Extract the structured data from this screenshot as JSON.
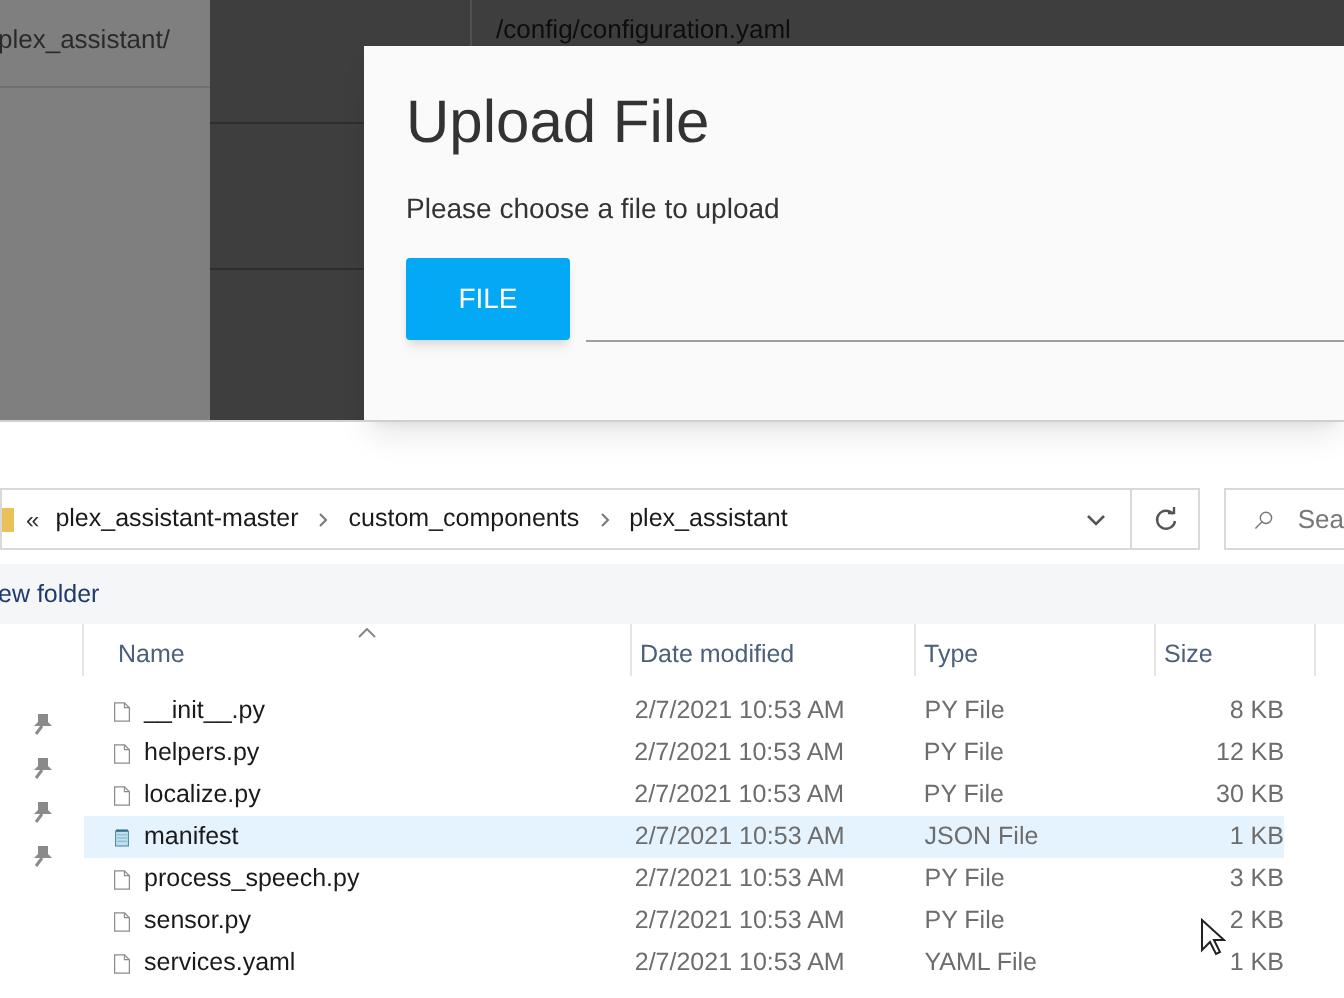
{
  "background_app": {
    "folder_path": "plex_assistant/",
    "file_path": "/config/configuration.yaml"
  },
  "dialog": {
    "title": "Upload File",
    "message": "Please choose a file to upload",
    "file_button": "FILE"
  },
  "explorer": {
    "breadcrumb": [
      "plex_assistant-master",
      "custom_components",
      "plex_assistant"
    ],
    "overflow": "«",
    "search_placeholder": "Sea",
    "toolbar": [
      "ew folder"
    ],
    "columns": [
      "Name",
      "Date modified",
      "Type",
      "Size"
    ],
    "rows": [
      {
        "kind": "file",
        "name": "__init__.py",
        "date": "2/7/2021 10:53 AM",
        "type": "PY File",
        "size": "8 KB",
        "selected": false
      },
      {
        "kind": "file",
        "name": "helpers.py",
        "date": "2/7/2021 10:53 AM",
        "type": "PY File",
        "size": "12 KB",
        "selected": false
      },
      {
        "kind": "file",
        "name": "localize.py",
        "date": "2/7/2021 10:53 AM",
        "type": "PY File",
        "size": "30 KB",
        "selected": false
      },
      {
        "kind": "notepad",
        "name": "manifest",
        "date": "2/7/2021 10:53 AM",
        "type": "JSON File",
        "size": "1 KB",
        "selected": true
      },
      {
        "kind": "file",
        "name": "process_speech.py",
        "date": "2/7/2021 10:53 AM",
        "type": "PY File",
        "size": "3 KB",
        "selected": false
      },
      {
        "kind": "file",
        "name": "sensor.py",
        "date": "2/7/2021 10:53 AM",
        "type": "PY File",
        "size": "2 KB",
        "selected": false
      },
      {
        "kind": "file",
        "name": "services.yaml",
        "date": "2/7/2021 10:53 AM",
        "type": "YAML File",
        "size": "1 KB",
        "selected": false
      }
    ]
  }
}
